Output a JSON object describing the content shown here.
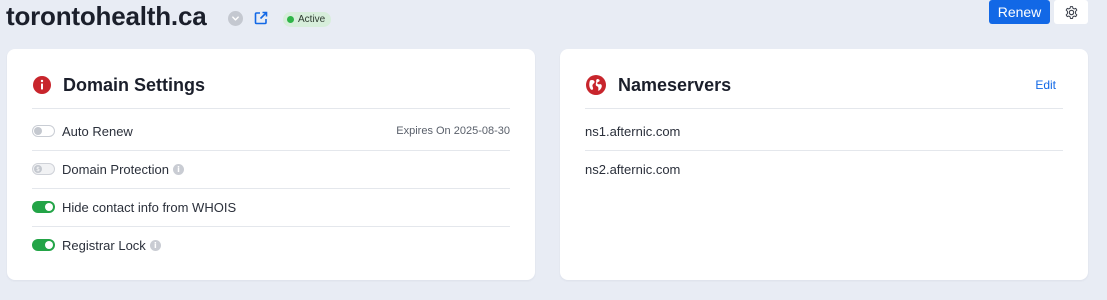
{
  "header": {
    "domain": "torontohealth.ca",
    "status": "Active",
    "renew_label": "Renew"
  },
  "domain_settings": {
    "title": "Domain Settings",
    "rows": [
      {
        "label": "Auto Renew",
        "state": "off",
        "info": false,
        "meta": "Expires On 2025-08-30"
      },
      {
        "label": "Domain Protection",
        "state": "disabled",
        "info": true
      },
      {
        "label": "Hide contact info from WHOIS",
        "state": "on",
        "info": false
      },
      {
        "label": "Registrar Lock",
        "state": "on",
        "info": true
      }
    ]
  },
  "nameservers": {
    "title": "Nameservers",
    "edit_label": "Edit",
    "items": [
      "ns1.afternic.com",
      "ns2.afternic.com"
    ]
  },
  "colors": {
    "accent": "#1268e6",
    "toggle_on": "#23a447",
    "status_dot": "#2fb548",
    "icon_red": "#c8252c",
    "background": "#e8ecf4"
  },
  "icons": [
    "chevron-down-icon",
    "external-link-icon",
    "gear-icon",
    "info-circle-icon",
    "globe-icon",
    "info-icon"
  ]
}
